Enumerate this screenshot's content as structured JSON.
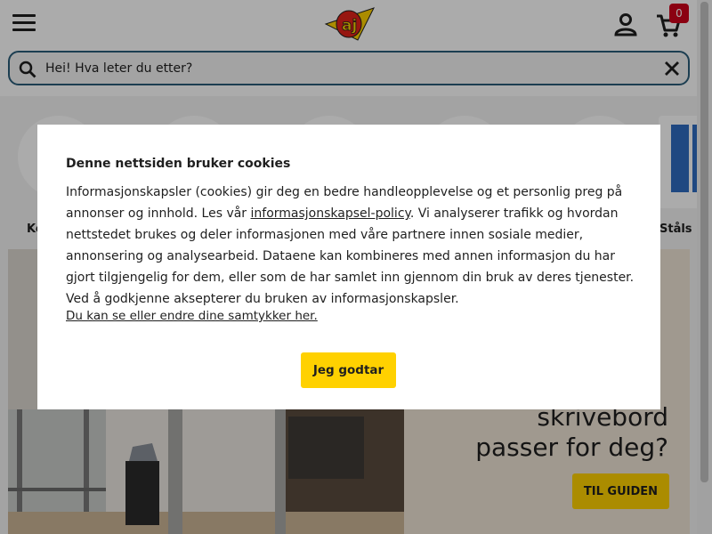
{
  "header": {
    "cart_count": "0",
    "search": {
      "placeholder": "Hei! Hva leter du etter?"
    }
  },
  "categories": {
    "visible_label_fragments": [
      "Ko",
      "Ståls"
    ]
  },
  "banner": {
    "heading_lines": [
      "skrivebord",
      "passer for deg?"
    ],
    "cta_label": "TIL GUIDEN"
  },
  "cookie_dialog": {
    "title": "Denne nettsiden bruker cookies",
    "body_part1": "Informasjonskapsler (cookies) gir deg en bedre handleopplevelse og et personlig preg på annonser og innhold.  Les vår ",
    "policy_link": "informasjonskapsel-policy",
    "body_part2": ". Vi analyserer trafikk og hvordan nettstedet brukes og deler informasjonen med våre partnere innen sosiale medier, annonsering og analysearbeid. Dataene kan kombineres med annen informasjon du har gjort tilgjengelig for dem, eller som de har samlet inn gjennom din bruk av deres tjenester. Ved å godkjenne aksepterer du bruken av informasjonskapsler.",
    "consent_link": "Du kan se eller endre dine samtykker her.",
    "accept_label": "Jeg godtar"
  },
  "colors": {
    "accent_yellow": "#ffd100",
    "logo_red": "#e2231a",
    "badge_red": "#d0021b",
    "search_border": "#2b5d7a"
  },
  "icons": [
    "menu-icon",
    "logo",
    "user-icon",
    "cart-icon",
    "search-icon",
    "close-icon"
  ]
}
